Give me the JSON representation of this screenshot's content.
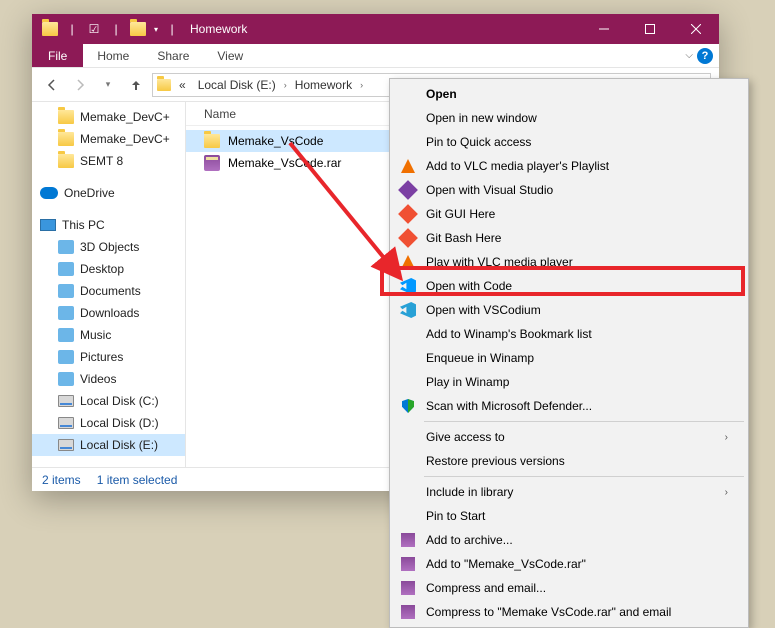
{
  "window": {
    "title": "Homework"
  },
  "menubar": {
    "file": "File",
    "items": [
      "Home",
      "Share",
      "View"
    ]
  },
  "nav": {
    "crumb_prefix": "«",
    "crumbs": [
      "Local Disk (E:)",
      "Homework"
    ]
  },
  "sidebar": {
    "quick": [
      {
        "label": "Memake_DevC+"
      },
      {
        "label": "Memake_DevC+"
      },
      {
        "label": "SEMT 8"
      }
    ],
    "onedrive": "OneDrive",
    "thispc": "This PC",
    "pcitems": [
      {
        "label": "3D Objects",
        "icon": "generic"
      },
      {
        "label": "Desktop",
        "icon": "generic"
      },
      {
        "label": "Documents",
        "icon": "generic"
      },
      {
        "label": "Downloads",
        "icon": "generic"
      },
      {
        "label": "Music",
        "icon": "generic"
      },
      {
        "label": "Pictures",
        "icon": "generic"
      },
      {
        "label": "Videos",
        "icon": "generic"
      },
      {
        "label": "Local Disk (C:)",
        "icon": "drive"
      },
      {
        "label": "Local Disk (D:)",
        "icon": "drive"
      },
      {
        "label": "Local Disk (E:)",
        "icon": "drive",
        "selected": true
      }
    ]
  },
  "content": {
    "col_name": "Name",
    "files": [
      {
        "name": "Memake_VsCode",
        "type": "folder",
        "selected": true
      },
      {
        "name": "Memake_VsCode.rar",
        "type": "rar"
      }
    ]
  },
  "statusbar": {
    "count": "2 items",
    "selection": "1 item selected"
  },
  "context_menu": [
    {
      "label": "Open",
      "bold": true
    },
    {
      "label": "Open in new window"
    },
    {
      "label": "Pin to Quick access"
    },
    {
      "label": "Add to VLC media player's Playlist",
      "icon": "vlc"
    },
    {
      "label": "Open with Visual Studio",
      "icon": "vs"
    },
    {
      "label": "Git GUI Here",
      "icon": "git"
    },
    {
      "label": "Git Bash Here",
      "icon": "git"
    },
    {
      "label": "Play with VLC media player",
      "icon": "vlc"
    },
    {
      "label": "Open with Code",
      "icon": "vscode",
      "highlighted": true
    },
    {
      "label": "Open with VSCodium",
      "icon": "codium"
    },
    {
      "label": "Add to Winamp's Bookmark list"
    },
    {
      "label": "Enqueue in Winamp"
    },
    {
      "label": "Play in Winamp"
    },
    {
      "label": "Scan with Microsoft Defender...",
      "icon": "shield"
    },
    {
      "sep": true
    },
    {
      "label": "Give access to",
      "submenu": true
    },
    {
      "label": "Restore previous versions"
    },
    {
      "sep": true
    },
    {
      "label": "Include in library",
      "submenu": true
    },
    {
      "label": "Pin to Start"
    },
    {
      "label": "Add to archive...",
      "icon": "winrar"
    },
    {
      "label": "Add to \"Memake_VsCode.rar\"",
      "icon": "winrar"
    },
    {
      "label": "Compress and email...",
      "icon": "winrar"
    },
    {
      "label": "Compress to \"Memake VsCode.rar\" and email",
      "icon": "winrar"
    }
  ]
}
